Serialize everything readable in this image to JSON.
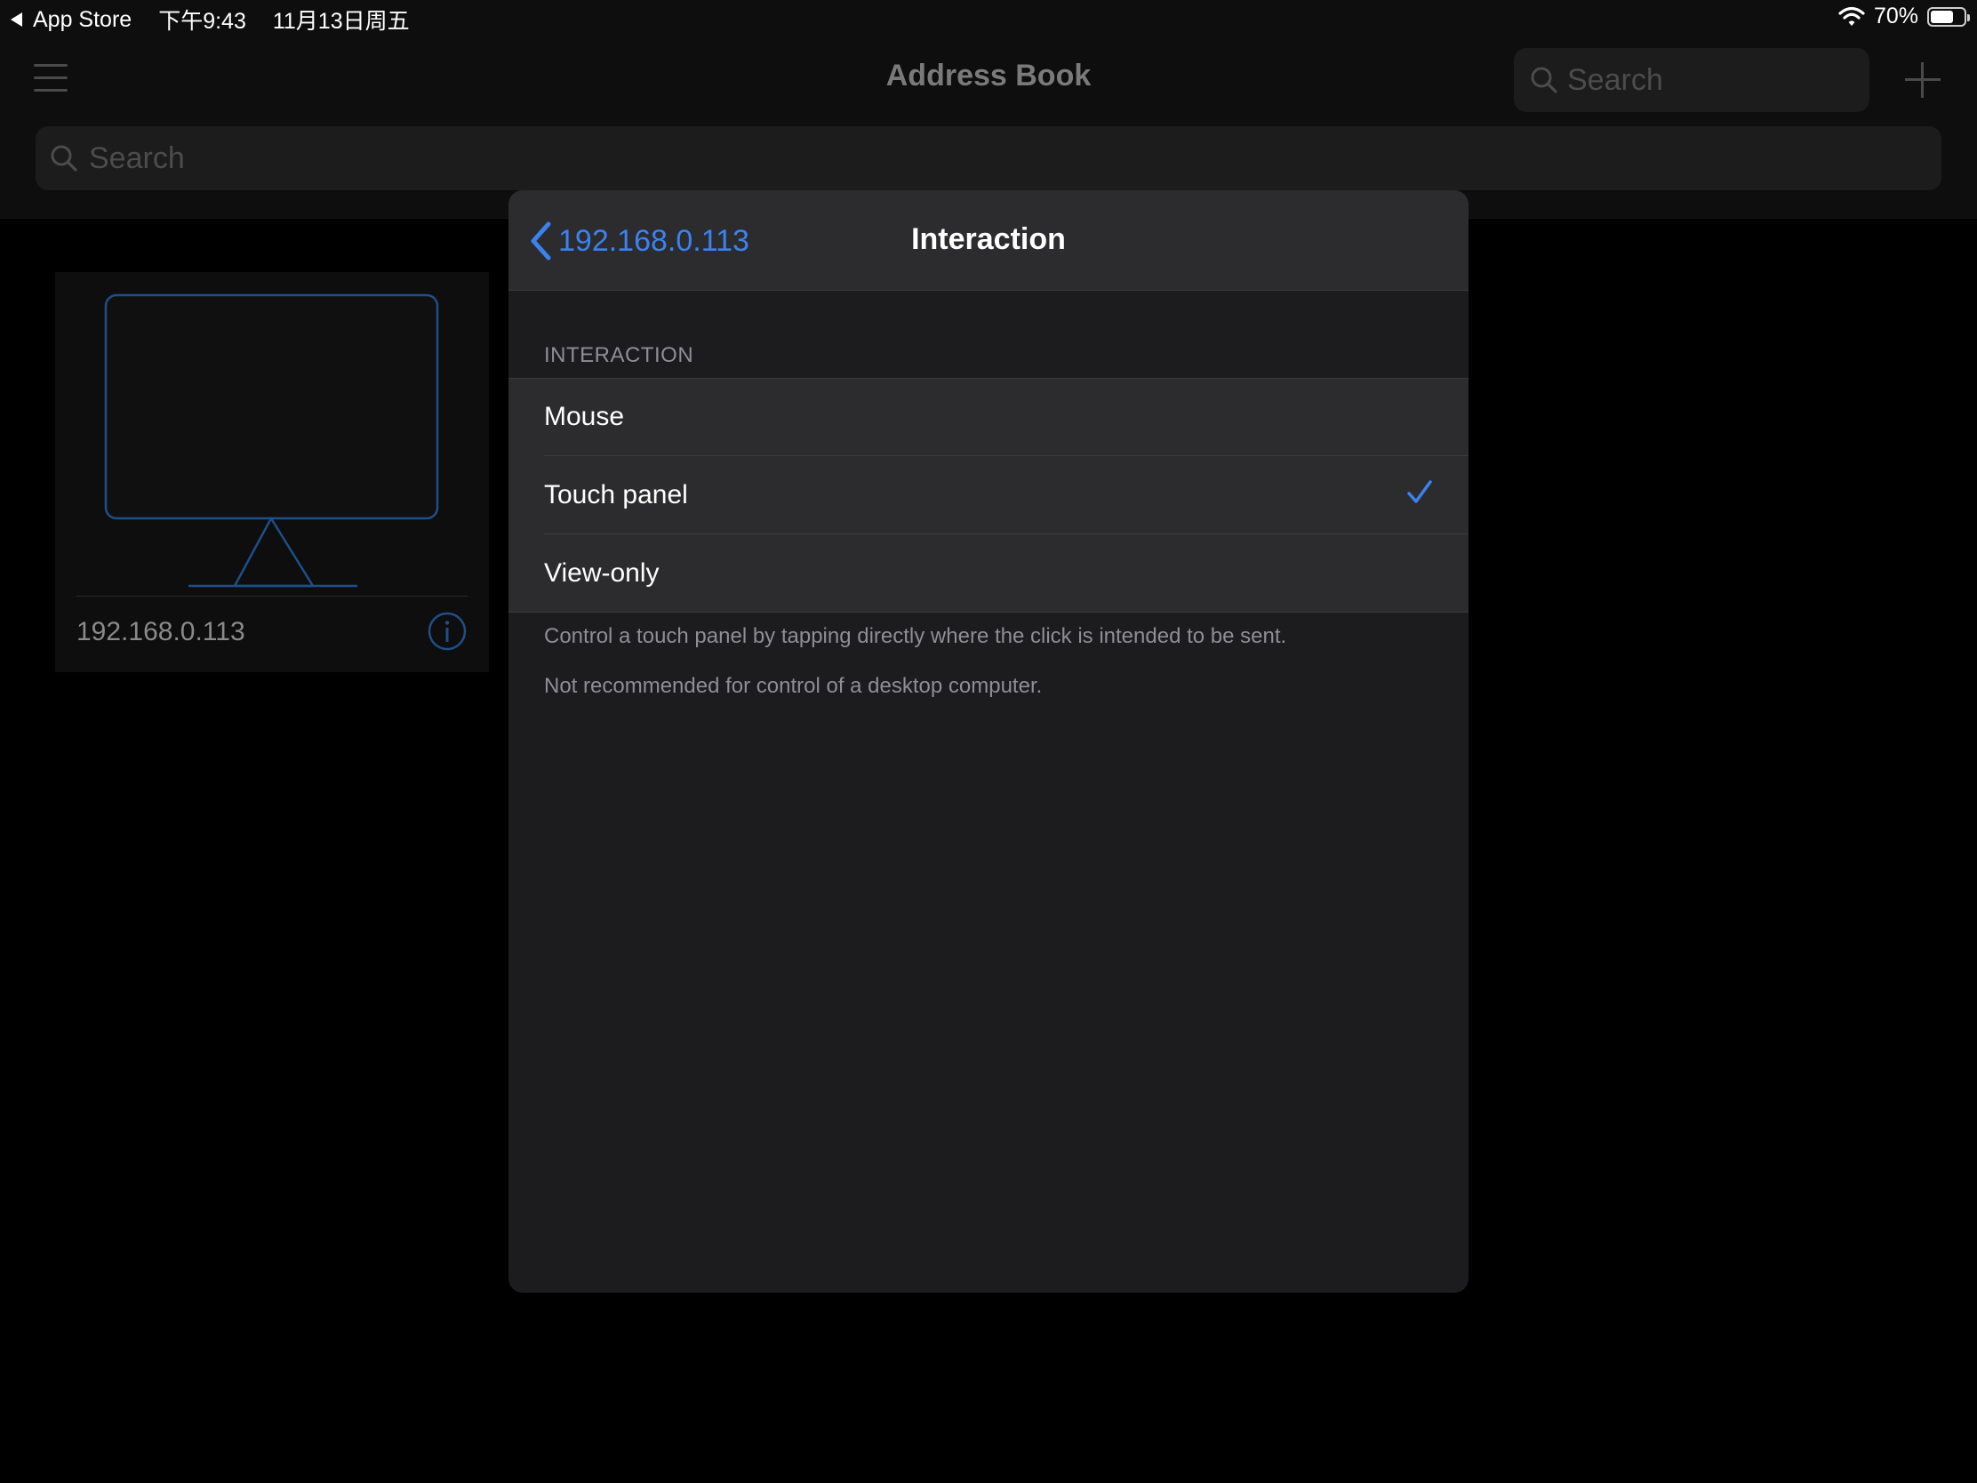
{
  "status_bar": {
    "back_app": "App Store",
    "time": "下午9:43",
    "date": "11月13日周五",
    "battery": "70%",
    "battery_level": 0.7
  },
  "address_book": {
    "title": "Address Book",
    "nav_search_placeholder": "Search",
    "search_placeholder": "Search",
    "connections": [
      {
        "label": "192.168.0.113"
      }
    ]
  },
  "interaction_sheet": {
    "back_label": "192.168.0.113",
    "title": "Interaction",
    "section_header": "INTERACTION",
    "options": [
      {
        "label": "Mouse",
        "selected": false
      },
      {
        "label": "Touch panel",
        "selected": true
      },
      {
        "label": "View-only",
        "selected": false
      }
    ],
    "footer_line1": "Control a touch panel by tapping directly where the click is intended to be sent.",
    "footer_line2": "Not recommended for control of a desktop computer."
  },
  "colors": {
    "accent": "#3b82f0",
    "sheet_background": "#1c1c1e",
    "group_background": "#2c2c2e",
    "secondary_text": "#8e8e93"
  },
  "icons": {
    "status_back": "back-triangle-icon",
    "wifi": "wifi-icon",
    "battery": "battery-icon",
    "menu": "hamburger-menu-icon",
    "search": "search-icon",
    "add": "plus-icon",
    "monitor": "monitor-icon",
    "info": "info-icon",
    "back": "chevron-left-icon",
    "selected": "checkmark-icon"
  }
}
